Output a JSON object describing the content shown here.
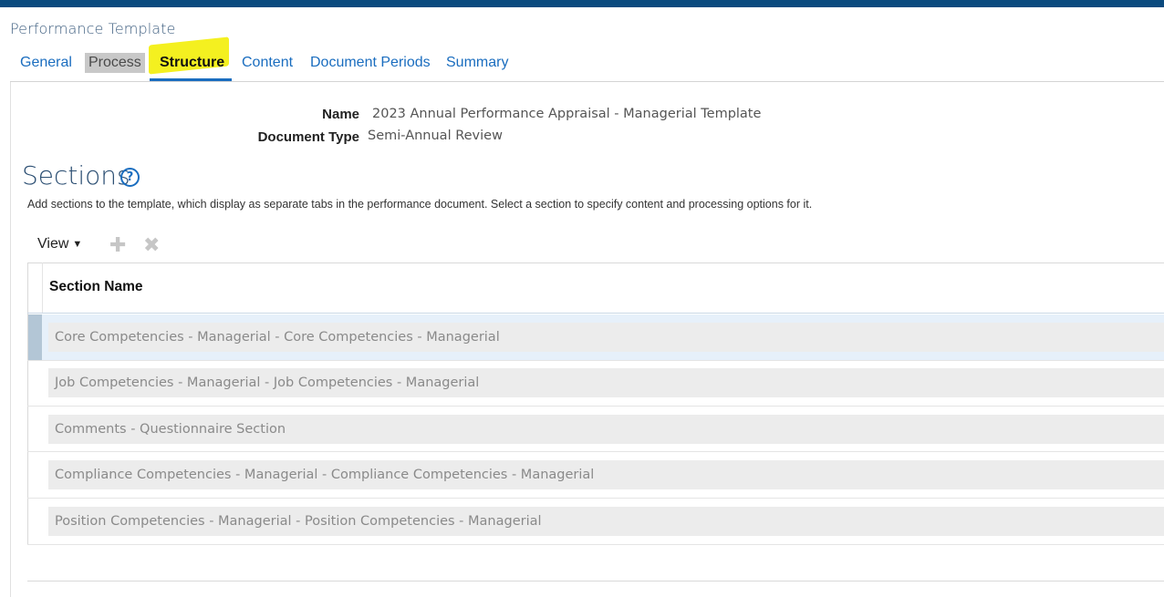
{
  "page": {
    "title": "Performance Template"
  },
  "tabs": [
    {
      "label": "General"
    },
    {
      "label": "Process"
    },
    {
      "label": "Structure"
    },
    {
      "label": "Content"
    },
    {
      "label": "Document Periods"
    },
    {
      "label": "Summary"
    }
  ],
  "fields": {
    "name_label": "Name",
    "name_value": "2023 Annual Performance Appraisal - Managerial Template",
    "doctype_label": "Document Type",
    "doctype_value": "Semi-Annual Review"
  },
  "sections": {
    "title": "Sections",
    "help_glyph": "?",
    "description": "Add sections to the template, which display as separate tabs in the performance document. Select a section to specify content and processing options for it."
  },
  "toolbar": {
    "view_label": "View",
    "add_icon": "plus-icon",
    "delete_icon": "close-icon"
  },
  "table": {
    "header": "Section Name",
    "rows": [
      "Core Competencies - Managerial  -  Core Competencies - Managerial",
      "Job Competencies - Managerial  -  Job Competencies - Managerial",
      "Comments  -  Questionnaire Section",
      "Compliance Competencies - Managerial  -  Compliance Competencies - Managerial",
      "Position Competencies - Managerial  -  Position Competencies - Managerial"
    ],
    "selected_row": 0
  },
  "colors": {
    "header_bar": "#0a4a7e",
    "tab_link": "#1a6dbf",
    "highlight": "#f4f020"
  }
}
